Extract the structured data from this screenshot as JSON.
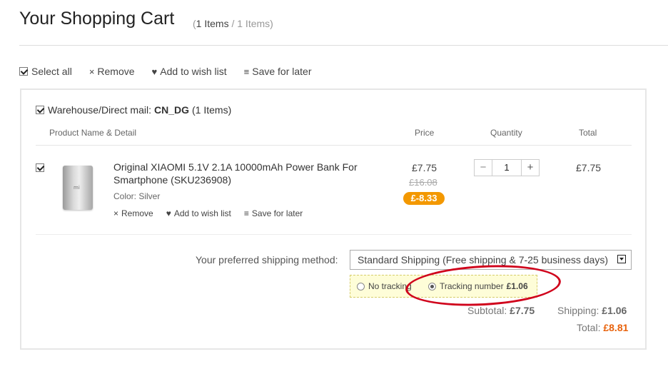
{
  "page": {
    "title": "Your Shopping Cart",
    "count_open": "(",
    "count_current": "1 Items",
    "count_sep": " / ",
    "count_total": "1 Items",
    "count_close": ")"
  },
  "toolbar": {
    "select_all": "Select all",
    "remove_icon": "×",
    "remove": "Remove",
    "wish_icon": "♥",
    "wish": "Add to wish list",
    "later_icon": "≡",
    "later": "Save for later"
  },
  "warehouse": {
    "prefix": "Warehouse/Direct mail:",
    "code": "CN_DG",
    "count": "(1 Items)"
  },
  "columns": {
    "product": "Product Name & Detail",
    "price": "Price",
    "quantity": "Quantity",
    "total": "Total"
  },
  "item": {
    "thumb_logo": "mi",
    "name": "Original XIAOMI 5.1V 2.1A 10000mAh Power Bank For Smartphone (SKU236908)",
    "color": "Color: Silver",
    "remove_icon": "×",
    "remove": "Remove",
    "wish_icon": "♥",
    "wish": "Add to wish list",
    "later_icon": "≡",
    "later": "Save for later",
    "price": "£7.75",
    "old_price": "£16.08",
    "discount": "£-8.33",
    "qty_minus": "−",
    "qty": "1",
    "qty_plus": "+",
    "total": "£7.75"
  },
  "shipping": {
    "label": "Your preferred shipping method:",
    "selected": "Standard Shipping (Free shipping & 7-25 business days)",
    "opt_no_tracking": "No tracking",
    "opt_tracking": "Tracking number",
    "opt_tracking_price": "£1.06"
  },
  "summary": {
    "subtotal_label": "Subtotal:",
    "subtotal": "£7.75",
    "shipping_label": "Shipping:",
    "shipping": "£1.06",
    "total_label": "Total:",
    "total": "£8.81"
  },
  "colors": {
    "discount_badge": "#f39800",
    "total_accent": "#e8620c",
    "annotation_circle": "#d0021b"
  }
}
